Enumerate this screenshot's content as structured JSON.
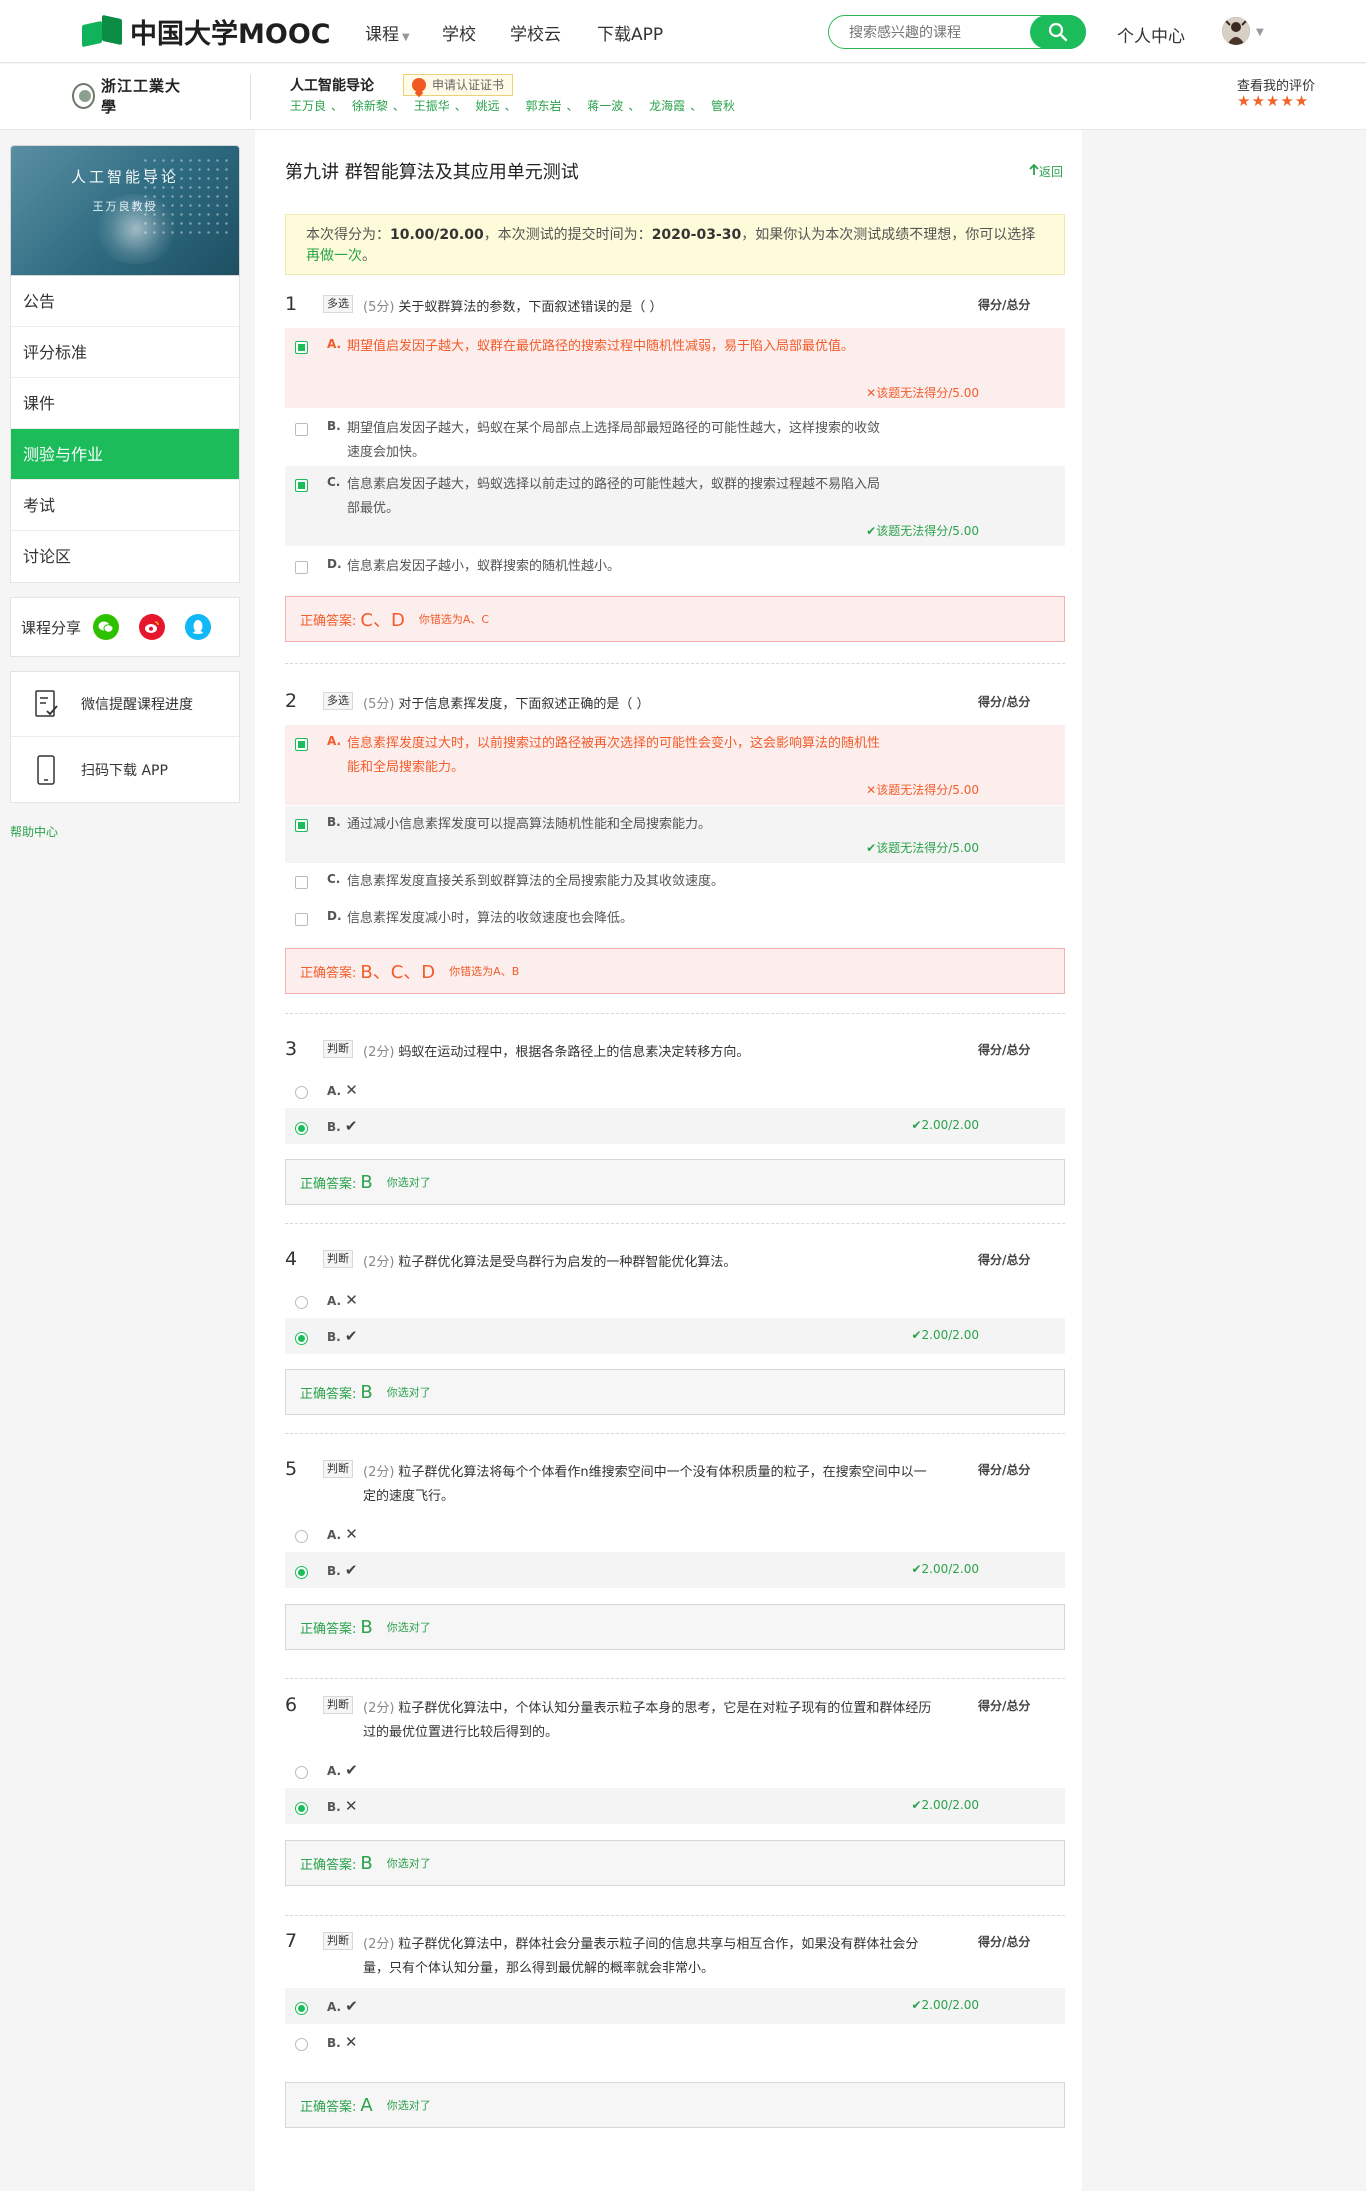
{
  "brand": {
    "name": "中国大学MOOC"
  },
  "nav": {
    "courses": "课程",
    "school": "学校",
    "school_cloud": "学校云",
    "download": "下载APP"
  },
  "search": {
    "placeholder": "搜索感兴趣的课程"
  },
  "user": {
    "personal": "个人中心"
  },
  "course": {
    "school": "浙江工業大學",
    "title": "人工智能导论",
    "cert": "申请认证证书",
    "teachers": [
      "王万良",
      "徐新黎",
      "王振华",
      "姚远",
      "郭东岩",
      "蒋一波",
      "龙海霞",
      "管秋"
    ],
    "my_eval": "查看我的评价",
    "stars": "★★★★★"
  },
  "sidebar": {
    "cover_title": "人工智能导论",
    "cover_sub": "王万良教授",
    "menu": [
      "公告",
      "评分标准",
      "课件",
      "测验与作业",
      "考试",
      "讨论区"
    ],
    "share_label": "课程分享",
    "wechat_tool": "微信提醒课程进度",
    "app_tool": "扫码下载 APP",
    "help": "帮助中心"
  },
  "page": {
    "title": "第九讲 群智能算法及其应用单元测试",
    "back": "返回",
    "score_prefix": "本次得分为：",
    "score": "10.00/20.00",
    "score_mid": "，本次测试的提交时间为：",
    "submit_time": "2020-03-30",
    "score_suffix": "，如果你认为本次测试成绩不理想，你可以选择",
    "redo": "再做一次",
    "period": "。"
  },
  "labels": {
    "score_total": "得分/总分",
    "correct_answer": "正确答案:"
  },
  "questions": [
    {
      "num": "1",
      "type": "多选",
      "points": "(5分)",
      "text": "关于蚁群算法的参数，下面叙述错误的是（ ）",
      "options": [
        {
          "letter": "A.",
          "text": "期望值启发因子越大，蚁群在最优路径的搜索过程中随机性减弱，易于陷入局部最优值。",
          "result": "该题无法得分/5.00"
        },
        {
          "letter": "B.",
          "text": "期望值启发因子越大，蚂蚁在某个局部点上选择局部最短路径的可能性越大，这样搜索的收敛速度会加快。",
          "result": ""
        },
        {
          "letter": "C.",
          "text": "信息素启发因子越大，蚂蚁选择以前走过的路径的可能性越大，蚁群的搜索过程越不易陷入局部最优。",
          "result": "该题无法得分/5.00"
        },
        {
          "letter": "D.",
          "text": "信息素启发因子越小，蚁群搜索的随机性越小。",
          "result": ""
        }
      ],
      "answer": "C、D",
      "note": "你错选为A、C"
    },
    {
      "num": "2",
      "type": "多选",
      "points": "(5分)",
      "text": "对于信息素挥发度，下面叙述正确的是（ ）",
      "options": [
        {
          "letter": "A.",
          "text": "信息素挥发度过大时，以前搜索过的路径被再次选择的可能性会变小，这会影响算法的随机性能和全局搜索能力。",
          "result": "该题无法得分/5.00"
        },
        {
          "letter": "B.",
          "text": "通过减小信息素挥发度可以提高算法随机性能和全局搜索能力。",
          "result": "该题无法得分/5.00"
        },
        {
          "letter": "C.",
          "text": "信息素挥发度直接关系到蚁群算法的全局搜索能力及其收敛速度。",
          "result": ""
        },
        {
          "letter": "D.",
          "text": "信息素挥发度减小时，算法的收敛速度也会降低。",
          "result": ""
        }
      ],
      "answer": "B、C、D",
      "note": "你错选为A、B"
    },
    {
      "num": "3",
      "type": "判断",
      "points": "(2分)",
      "text": "蚂蚁在运动过程中，根据各条路径上的信息素决定转移方向。",
      "options": [
        {
          "letter": "A.",
          "mark": "✕",
          "result": ""
        },
        {
          "letter": "B.",
          "mark": "✔",
          "result": "2.00/2.00"
        }
      ],
      "answer": "B",
      "note": "你选对了"
    },
    {
      "num": "4",
      "type": "判断",
      "points": "(2分)",
      "text": "粒子群优化算法是受鸟群行为启发的一种群智能优化算法。",
      "options": [
        {
          "letter": "A.",
          "mark": "✕",
          "result": ""
        },
        {
          "letter": "B.",
          "mark": "✔",
          "result": "2.00/2.00"
        }
      ],
      "answer": "B",
      "note": "你选对了"
    },
    {
      "num": "5",
      "type": "判断",
      "points": "(2分)",
      "text": "粒子群优化算法将每个个体看作n维搜索空间中一个没有体积质量的粒子，在搜索空间中以一定的速度飞行。",
      "options": [
        {
          "letter": "A.",
          "mark": "✕",
          "result": ""
        },
        {
          "letter": "B.",
          "mark": "✔",
          "result": "2.00/2.00"
        }
      ],
      "answer": "B",
      "note": "你选对了"
    },
    {
      "num": "6",
      "type": "判断",
      "points": "(2分)",
      "text": "粒子群优化算法中，个体认知分量表示粒子本身的思考，它是在对粒子现有的位置和群体经历过的最优位置进行比较后得到的。",
      "options": [
        {
          "letter": "A.",
          "mark": "✔",
          "result": ""
        },
        {
          "letter": "B.",
          "mark": "✕",
          "result": "2.00/2.00"
        }
      ],
      "answer": "B",
      "note": "你选对了"
    },
    {
      "num": "7",
      "type": "判断",
      "points": "(2分)",
      "text": "粒子群优化算法中，群体社会分量表示粒子间的信息共享与相互合作，如果没有群体社会分量，只有个体认知分量，那么得到最优解的概率就会非常小。",
      "options": [
        {
          "letter": "A.",
          "mark": "✔",
          "result": "2.00/2.00"
        },
        {
          "letter": "B.",
          "mark": "✕",
          "result": ""
        }
      ],
      "answer": "A",
      "note": "你选对了"
    }
  ],
  "colors": {
    "green": "#1dbc5b",
    "orange": "#f25c2a"
  }
}
